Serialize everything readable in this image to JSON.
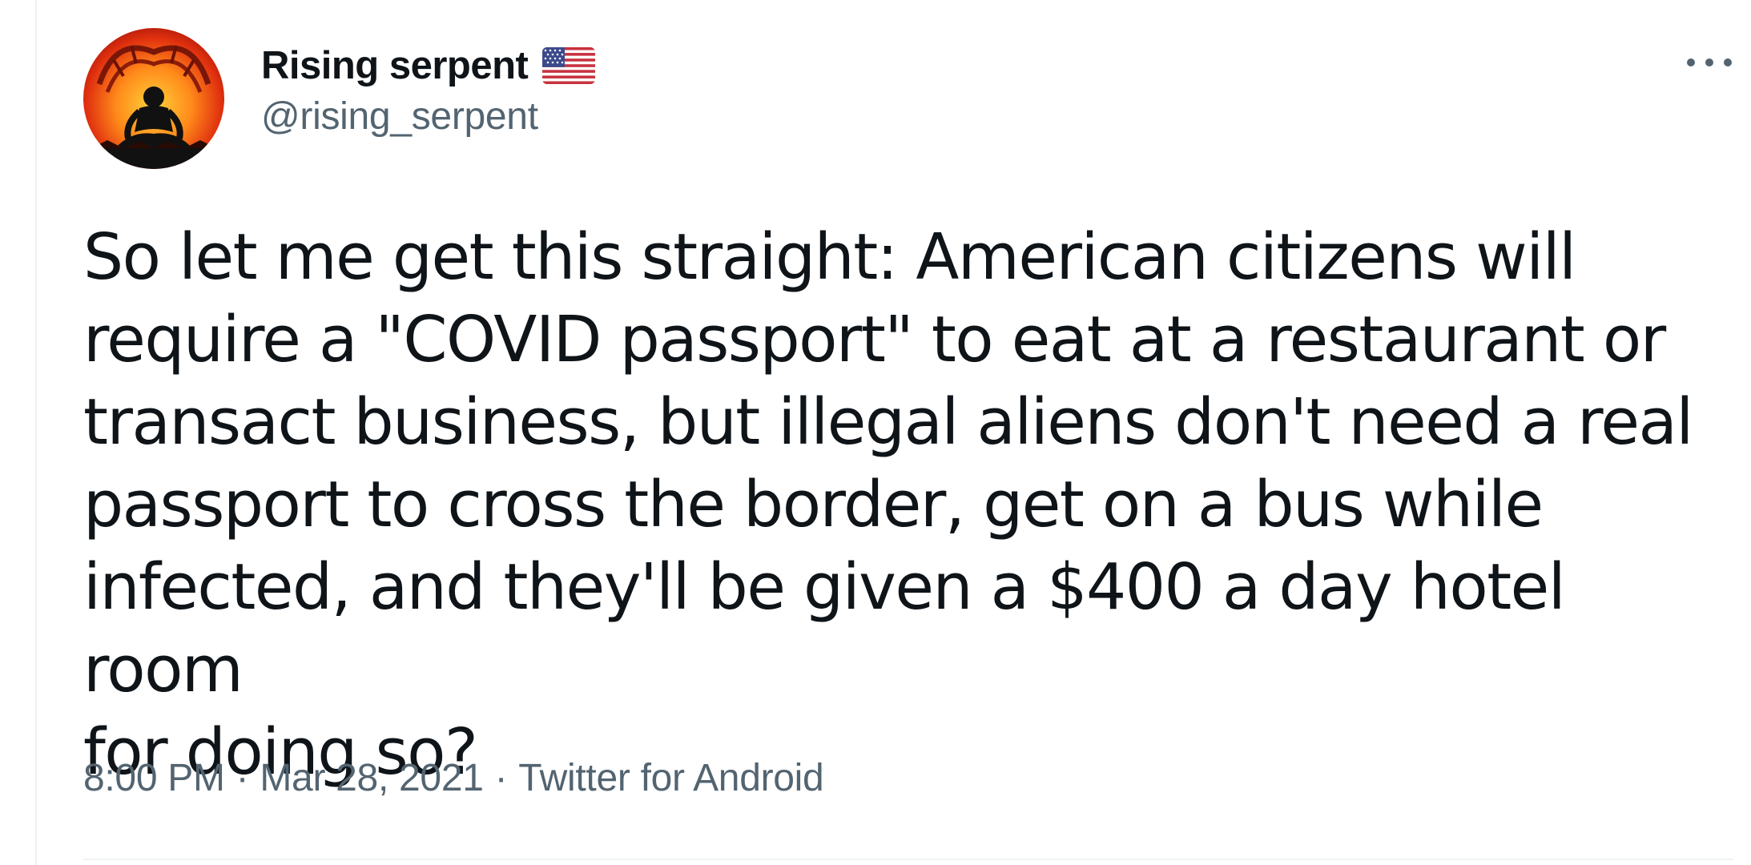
{
  "tweet": {
    "display_name": "Rising serpent",
    "handle": "@rising_serpent",
    "badge_icon": "us-flag-icon",
    "text": "So let me get this straight: American citizens will\nrequire a \"COVID passport\" to eat at a restaurant or\ntransact business, but illegal aliens don't need a real\npassport to cross the border, get on a bus while\ninfected, and they'll be given a $400 a day hotel room\nfor doing so?",
    "time": "8:00 PM",
    "date": "Mar 28, 2021",
    "source": "Twitter for Android",
    "separator": "·",
    "more_icon": "more-horizontal-icon"
  },
  "colors": {
    "text_primary": "#0f1419",
    "text_secondary": "#536471",
    "divider": "#eff3f4",
    "background": "#ffffff"
  }
}
